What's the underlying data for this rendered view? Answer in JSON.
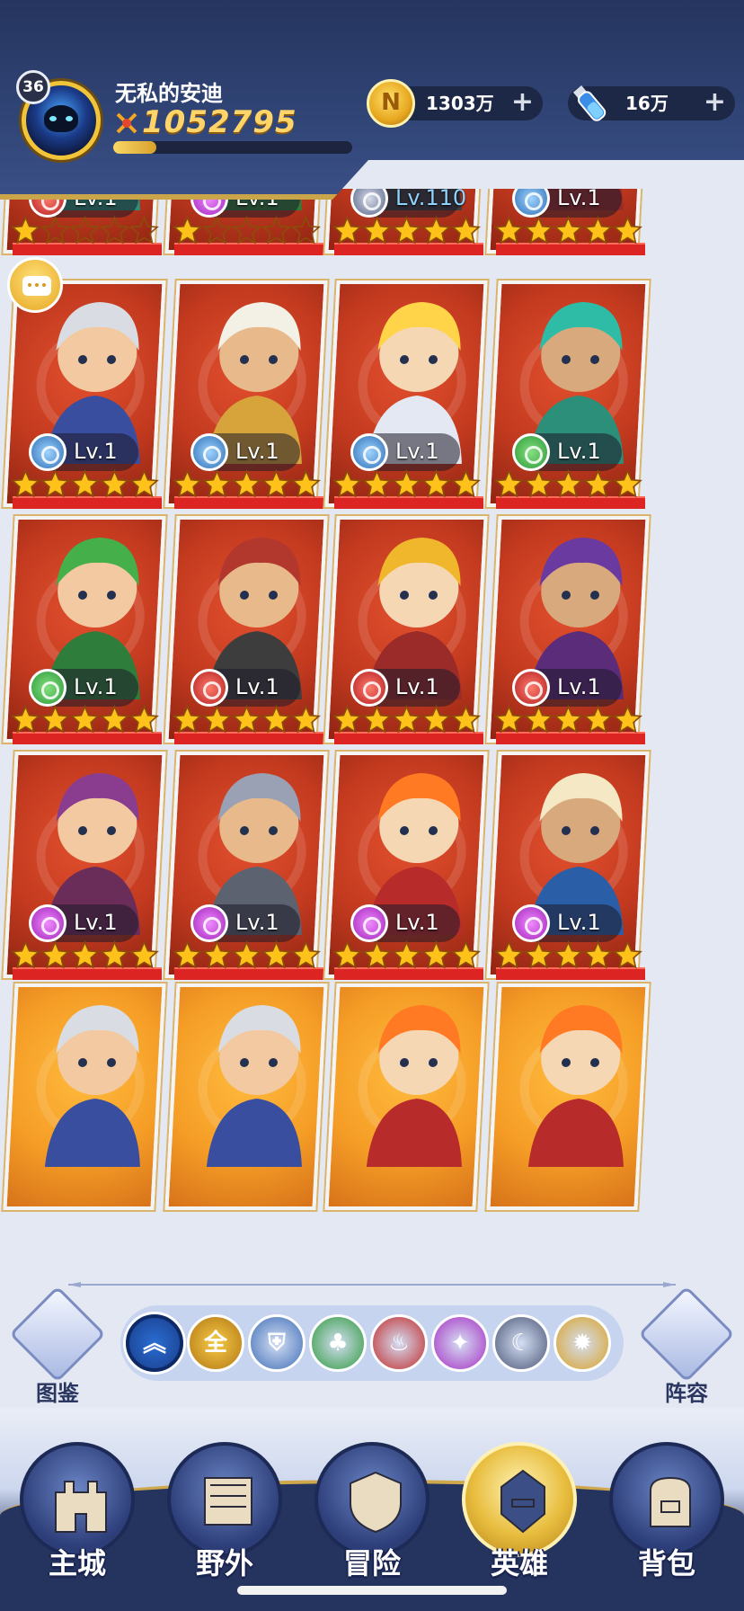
{
  "player": {
    "level": "36",
    "name": "无私的安迪",
    "power": "1052795",
    "exp_progress": 0.18
  },
  "resources": {
    "gold": {
      "value": "1303万",
      "icon": "gold-coin-icon",
      "plus": "+"
    },
    "potion": {
      "value": "16万",
      "icon": "potion-icon",
      "plus": "+"
    }
  },
  "top_row": [
    {
      "level": "Lv.1",
      "faction": "fire",
      "stars": 1
    },
    {
      "level": "Lv.1",
      "faction": "dark",
      "stars": 1
    },
    {
      "level": "Lv.110",
      "faction": "moon",
      "stars": 5
    },
    {
      "level": "Lv.1",
      "faction": "ice",
      "stars": 5
    }
  ],
  "heroes": [
    {
      "level": "Lv.1",
      "faction": "ice",
      "stars": 5,
      "bg": "red"
    },
    {
      "level": "Lv.1",
      "faction": "ice",
      "stars": 5,
      "bg": "red"
    },
    {
      "level": "Lv.1",
      "faction": "ice",
      "stars": 5,
      "bg": "red"
    },
    {
      "level": "Lv.1",
      "faction": "wind",
      "stars": 5,
      "bg": "red"
    },
    {
      "level": "Lv.1",
      "faction": "wind",
      "stars": 5,
      "bg": "red"
    },
    {
      "level": "Lv.1",
      "faction": "fire",
      "stars": 5,
      "bg": "red"
    },
    {
      "level": "Lv.1",
      "faction": "fire",
      "stars": 5,
      "bg": "red"
    },
    {
      "level": "Lv.1",
      "faction": "fire",
      "stars": 5,
      "bg": "red"
    },
    {
      "level": "Lv.1",
      "faction": "dark",
      "stars": 5,
      "bg": "red"
    },
    {
      "level": "Lv.1",
      "faction": "dark",
      "stars": 5,
      "bg": "red"
    },
    {
      "level": "Lv.1",
      "faction": "dark",
      "stars": 5,
      "bg": "red"
    },
    {
      "level": "Lv.1",
      "faction": "dark",
      "stars": 5,
      "bg": "red"
    }
  ],
  "bottom_row": [
    {
      "bg": "orange"
    },
    {
      "bg": "orange"
    },
    {
      "bg": "orange"
    },
    {
      "bg": "orange"
    }
  ],
  "side_buttons": {
    "left": "图鉴",
    "right": "阵容"
  },
  "filters": [
    {
      "id": "sort",
      "label": "",
      "icon": "double-chevron-up-icon",
      "active": true
    },
    {
      "id": "all",
      "label": "全",
      "icon": "",
      "active": false
    },
    {
      "id": "ice",
      "label": "",
      "icon": "helmet-faction-icon",
      "active": false
    },
    {
      "id": "wind",
      "label": "",
      "icon": "tree-faction-icon",
      "active": false
    },
    {
      "id": "fire",
      "label": "",
      "icon": "flame-faction-icon",
      "active": false
    },
    {
      "id": "dark",
      "label": "",
      "icon": "skull-faction-icon",
      "active": false
    },
    {
      "id": "moon",
      "label": "",
      "icon": "moon-faction-icon",
      "active": false
    },
    {
      "id": "sun",
      "label": "",
      "icon": "sun-faction-icon",
      "active": false
    }
  ],
  "nav": [
    {
      "label": "主城",
      "icon": "castle-icon",
      "active": false
    },
    {
      "label": "野外",
      "icon": "map-scroll-icon",
      "active": false
    },
    {
      "label": "冒险",
      "icon": "shield-icon",
      "active": false
    },
    {
      "label": "英雄",
      "icon": "hero-helmet-icon",
      "active": true
    },
    {
      "label": "背包",
      "icon": "backpack-icon",
      "active": false
    }
  ],
  "colors": {
    "header": "#2f4374",
    "gold_trim": "#caa549",
    "card_red": "#c33a1f",
    "card_orange": "#f59d26",
    "star": "#ffc21a"
  }
}
